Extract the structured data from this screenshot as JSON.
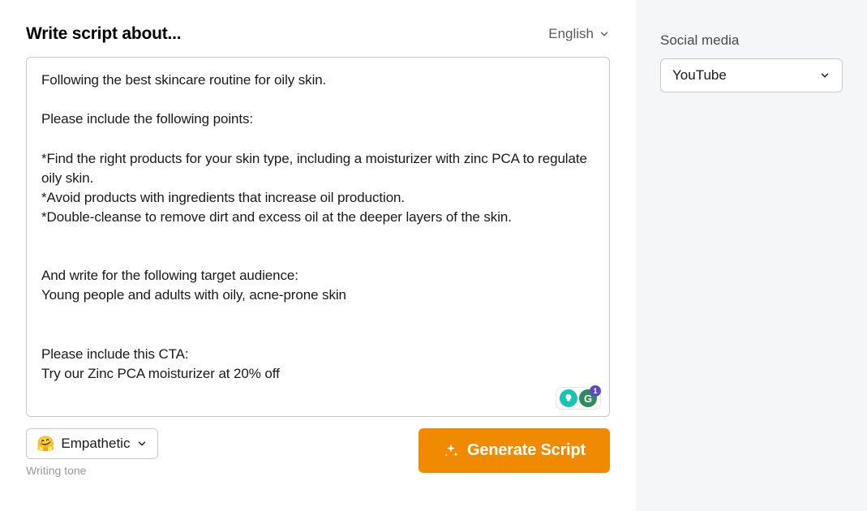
{
  "header": {
    "title": "Write script about...",
    "language": "English"
  },
  "textarea": {
    "value": "Following the best skincare routine for oily skin.\n\nPlease include the following points:\n\n*Find the right products for your skin type, including a moisturizer with zinc PCA to regulate oily skin.\n*Avoid products with ingredients that increase oil production.\n*Double-cleanse to remove dirt and excess oil at the deeper layers of the skin.\n\n\nAnd write for the following target audience:\nYoung people and adults with oily, acne-prone skin\n\n\nPlease include this CTA:\nTry our Zinc PCA moisturizer at 20% off"
  },
  "grammarly_badge": {
    "count": "1"
  },
  "tone": {
    "emoji": "🤗",
    "value": "Empathetic",
    "caption": "Writing tone"
  },
  "generate": {
    "label": "Generate Script"
  },
  "sidebar": {
    "label": "Social media",
    "value": "YouTube"
  }
}
